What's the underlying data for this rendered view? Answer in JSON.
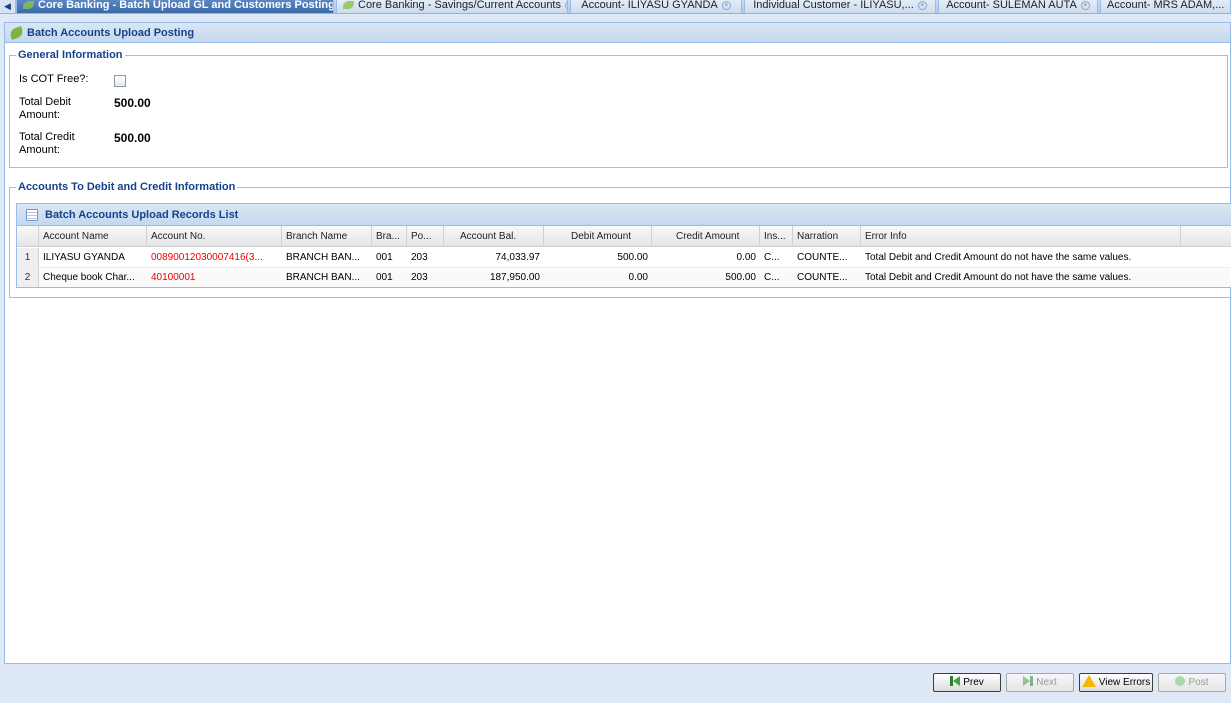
{
  "tabs": [
    {
      "label": "Core Banking - Batch Upload GL and Customers Posting",
      "active": true
    },
    {
      "label": "Core Banking - Savings/Current Accounts",
      "active": false
    },
    {
      "label": "Account- ILIYASU GYANDA",
      "active": false
    },
    {
      "label": "Individual Customer - ILIYASU,...",
      "active": false
    },
    {
      "label": "Account- SULEMAN AUTA",
      "active": false
    },
    {
      "label": "Account- MRS ADAM,...",
      "active": false
    }
  ],
  "panel": {
    "title": "Batch Accounts Upload Posting"
  },
  "general": {
    "legend": "General Information",
    "cot_label": "Is COT Free?:",
    "total_debit_label": "Total Debit Amount:",
    "total_debit_value": "500.00",
    "total_credit_label": "Total Credit Amount:",
    "total_credit_value": "500.00"
  },
  "accounts": {
    "legend": "Accounts To Debit and Credit Information",
    "grid_title": "Batch Accounts Upload Records List",
    "columns": [
      "Account Name",
      "Account No.",
      "Branch Name",
      "Bra...",
      "Po...",
      "Account Bal.",
      "Debit Amount",
      "Credit Amount",
      "Ins...",
      "Narration",
      "Error Info"
    ],
    "rows": [
      {
        "num": "1",
        "name": "ILIYASU GYANDA",
        "acct": "00890012030007416(3...",
        "branch": "BRANCH BAN...",
        "bra": "001",
        "po": "203",
        "bal": "74,033.97",
        "debit": "500.00",
        "credit": "0.00",
        "ins": "C...",
        "narr": "COUNTE...",
        "err": "Total Debit and Credit Amount do not have the same values."
      },
      {
        "num": "2",
        "name": "Cheque book Char...",
        "acct": "40100001",
        "branch": "BRANCH BAN...",
        "bra": "001",
        "po": "203",
        "bal": "187,950.00",
        "debit": "0.00",
        "credit": "500.00",
        "ins": "C...",
        "narr": "COUNTE...",
        "err": "Total Debit and Credit Amount do not have the same values."
      }
    ]
  },
  "buttons": {
    "prev": "Prev",
    "next": "Next",
    "view_errors": "View Errors",
    "post": "Post"
  },
  "colors": {
    "accent": "#15428b",
    "account_no": "#e00000",
    "tab_active": "#3a6aa8"
  }
}
